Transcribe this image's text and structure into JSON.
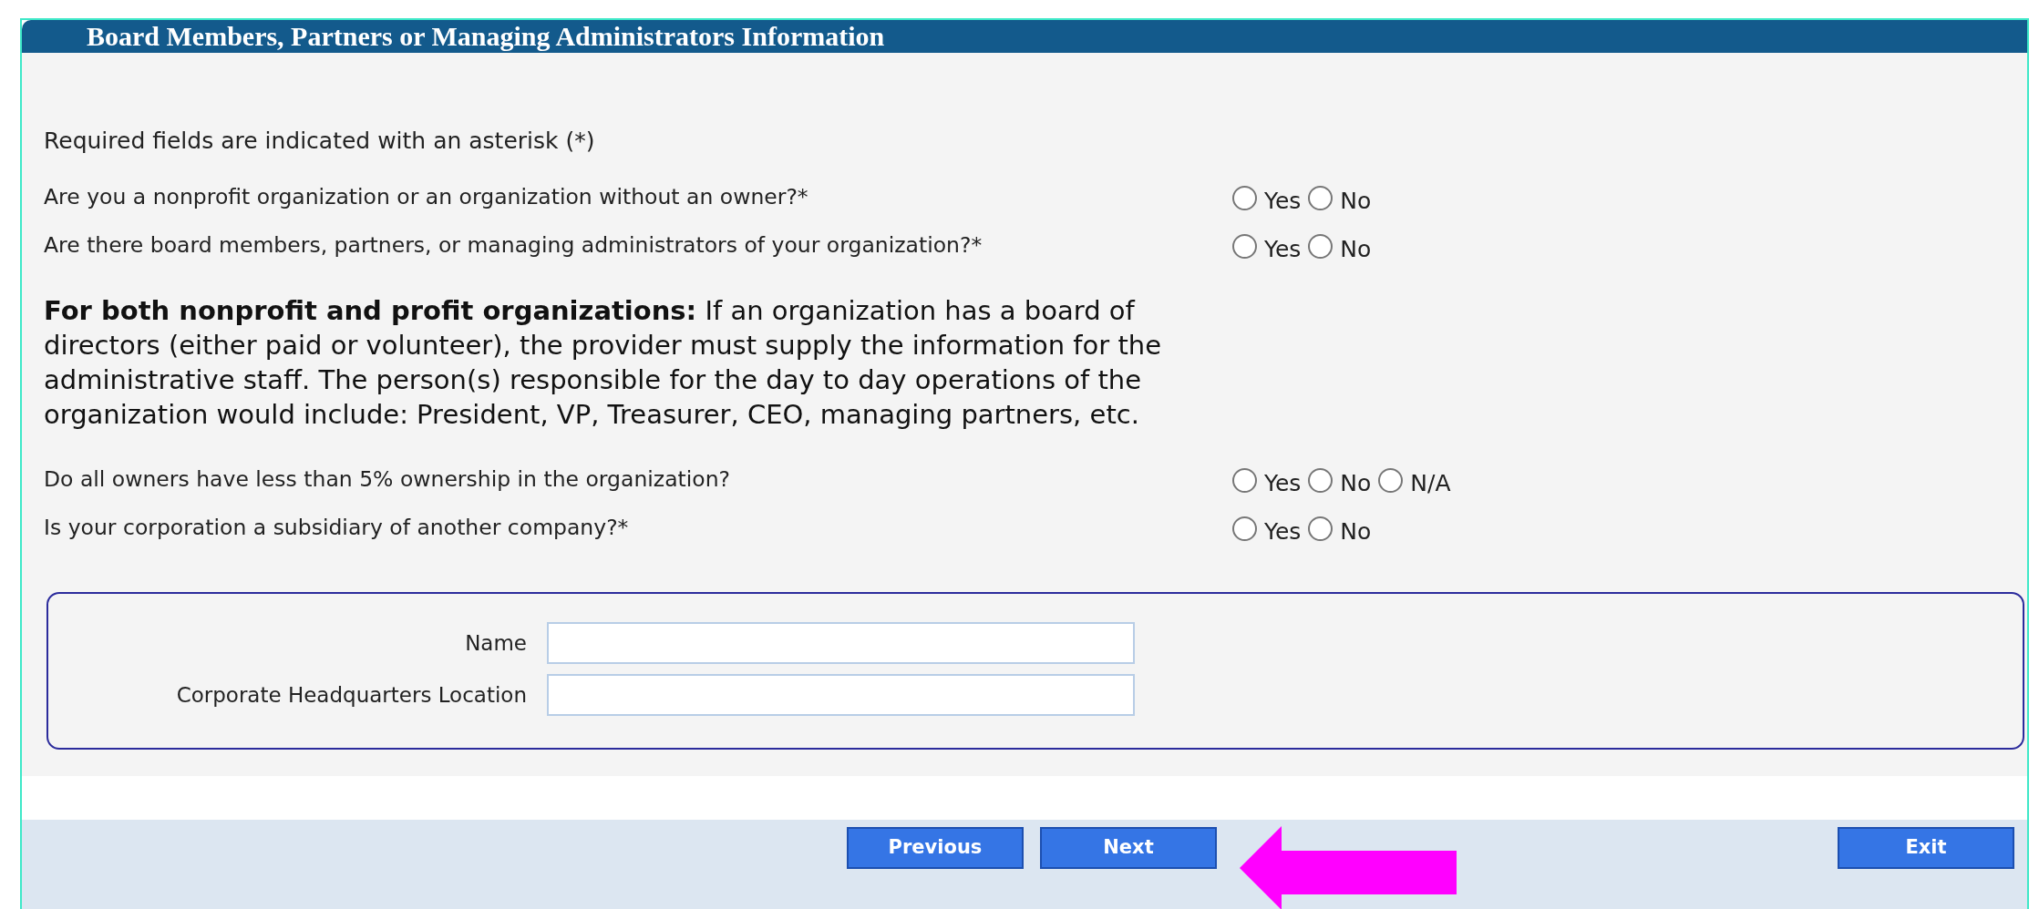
{
  "header": {
    "title": "Board Members, Partners or Managing Administrators Information"
  },
  "required_note": "Required fields are indicated with an asterisk (*)",
  "questions": [
    {
      "text": "Are you a nonprofit organization or an organization without an owner?*",
      "options": [
        {
          "label": "Yes",
          "selected": false
        },
        {
          "label": "No",
          "selected": false
        }
      ]
    },
    {
      "text": "Are there board members, partners, or managing administrators of your organization?*",
      "options": [
        {
          "label": "Yes",
          "selected": false
        },
        {
          "label": "No",
          "selected": false
        }
      ]
    },
    {
      "kind": "notice",
      "text": "**For both nonprofit and profit organizations:** If an organization has a board of directors (either paid or volunteer), the provider must supply the information for the administrative staff. The person(s) responsible for the day to day operations of the organization would include: President, VP, Treasurer, CEO, managing partners, etc."
    },
    {
      "text": "Do all owners have less than 5% ownership in the organization?",
      "options": [
        {
          "label": "Yes",
          "selected": false
        },
        {
          "label": "No",
          "selected": false
        },
        {
          "label": "N/A",
          "selected": false
        }
      ]
    },
    {
      "text": "Is your corporation a subsidiary of another company?*",
      "options": [
        {
          "label": "Yes",
          "selected": false
        },
        {
          "label": "No",
          "selected": false
        }
      ]
    }
  ],
  "subsidiary_fields": [
    {
      "label": "Name"
    },
    {
      "label": "Corporate Headquarters Location"
    }
  ],
  "buttons": [
    {
      "label": "Previous",
      "kind": "center"
    },
    {
      "label": "Next",
      "kind": "center"
    },
    {
      "label": "Exit",
      "kind": "right"
    }
  ]
}
